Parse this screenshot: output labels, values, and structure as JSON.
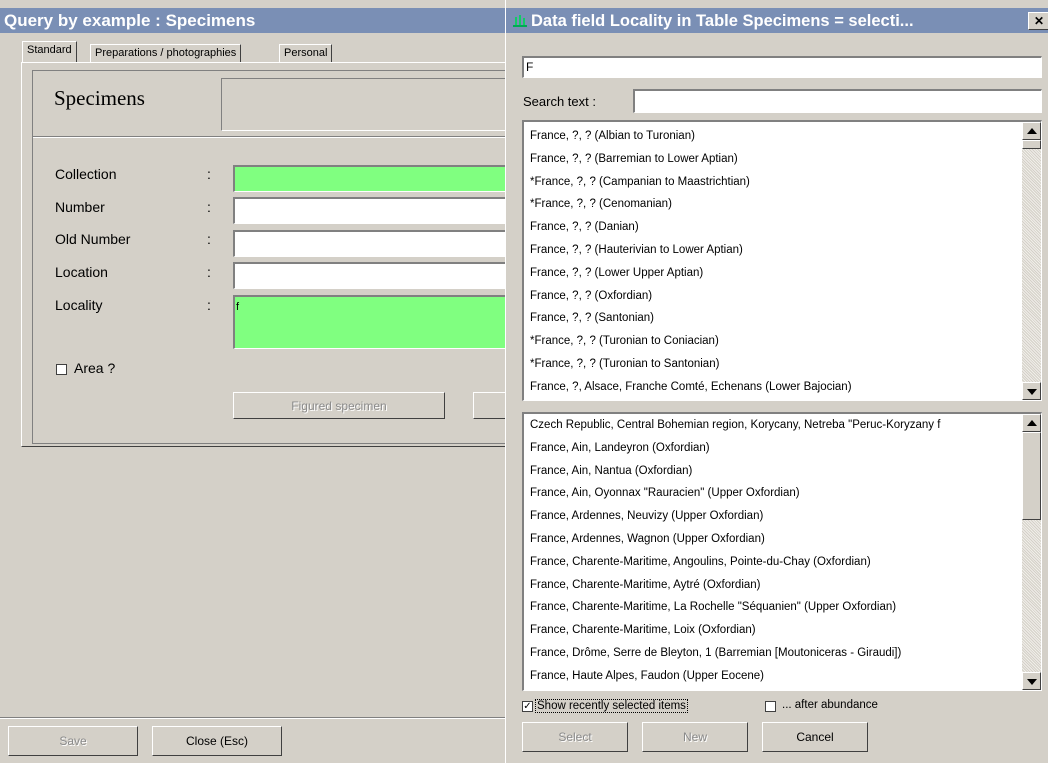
{
  "left": {
    "window_title": "Query by example : Specimens",
    "tabs": [
      "Standard",
      "Preparations / photographies",
      "Personal"
    ],
    "heading": "Specimens",
    "fields": {
      "collection": "Collection",
      "number": "Number",
      "old_number": "Old Number",
      "location": "Location",
      "locality": "Locality",
      "locality_value": "f",
      "colon": ":"
    },
    "area_label": "Area ?",
    "figured_button": "Figured specimen",
    "save_button": "Save",
    "close_button": "Close (Esc)"
  },
  "dialog": {
    "title": "Data field Locality in Table Specimens = selecti...",
    "close_glyph": "✕",
    "filter_value": "F",
    "search_label": "Search text :",
    "search_value": "",
    "recent_items": [
      "France, ?, ? (Albian to Turonian)",
      "France, ?, ? (Barremian to Lower Aptian)",
      "*France, ?, ? (Campanian to Maastrichtian)",
      "*France, ?, ? (Cenomanian)",
      "France, ?, ? (Danian)",
      "France, ?, ? (Hauterivian to Lower Aptian)",
      "France, ?, ? (Lower Upper Aptian)",
      "France, ?, ? (Oxfordian)",
      "France, ?, ? (Santonian)",
      "*France, ?, ? (Turonian to Coniacian)",
      "*France, ?, ? (Turonian to Santonian)",
      "France, ?, Alsace, Franche Comté, Echenans (Lower Bajocian)"
    ],
    "all_items": [
      "Czech Republic, Central Bohemian region, Korycany, Netreba \"Peruc-Koryzany f",
      "France, Ain, Landeyron (Oxfordian)",
      "France, Ain, Nantua (Oxfordian)",
      "France, Ain, Oyonnax \"Rauracien\" (Upper Oxfordian)",
      "France, Ardennes, Neuvizy (Upper Oxfordian)",
      "France, Ardennes, Wagnon (Upper Oxfordian)",
      "France, Charente-Maritime, Angoulins, Pointe-du-Chay (Oxfordian)",
      "France, Charente-Maritime, Aytré (Oxfordian)",
      "France, Charente-Maritime, La Rochelle \"Séquanien\" (Upper Oxfordian)",
      "France, Charente-Maritime, Loix (Oxfordian)",
      "France, Drôme, Serre de Bleyton, 1 (Barremian [Moutoniceras - Giraudi])",
      "France, Haute Alpes, Faudon (Upper Eocene)"
    ],
    "show_recent_label": "Show recently selected items",
    "show_recent_checked": "✓",
    "after_abundance_label": "... after abundance",
    "select_button": "Select",
    "new_button": "New",
    "cancel_button": "Cancel"
  },
  "colors": {
    "title_blue": "#7a8fb5",
    "field_green": "#80ff80"
  }
}
